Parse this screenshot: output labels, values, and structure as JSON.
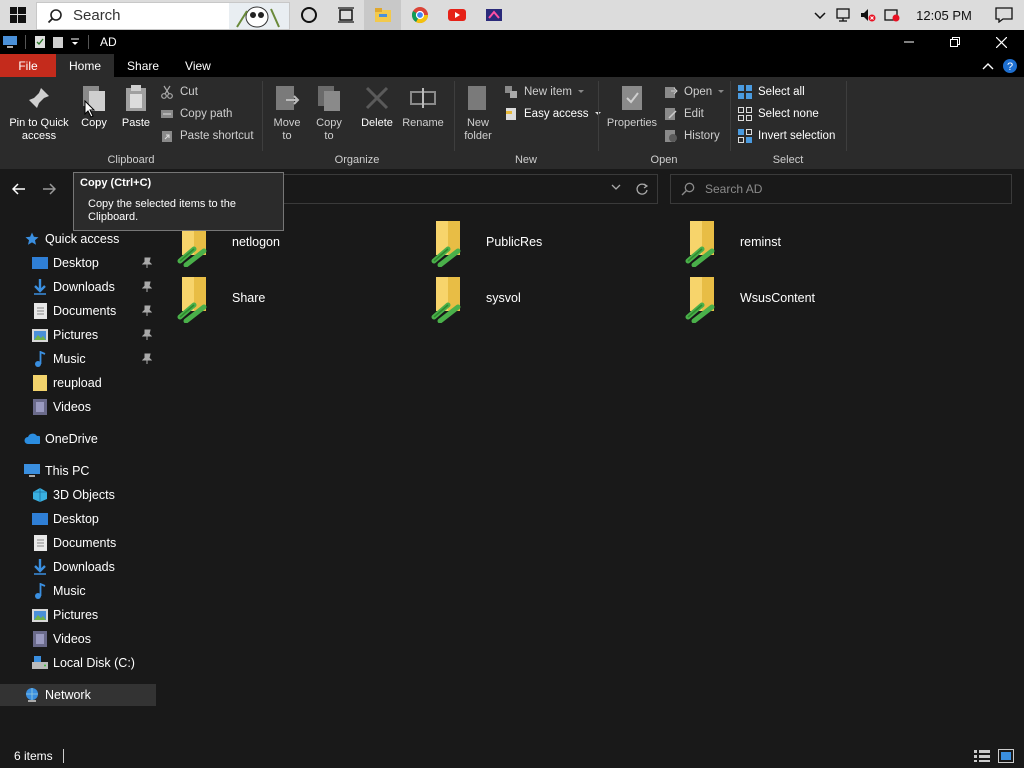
{
  "taskbar": {
    "search_placeholder": "Search",
    "clock": "12:05 PM",
    "pinned": [
      "cortana-icon",
      "task-view-icon",
      "file-explorer-icon",
      "chrome-icon",
      "youtube-icon",
      "video-editor-icon"
    ]
  },
  "window": {
    "title": "AD"
  },
  "ribbon_tabs": [
    "File",
    "Home",
    "Share",
    "View"
  ],
  "ribbon": {
    "clipboard": {
      "label": "Clipboard",
      "pin": "Pin to Quick access",
      "pin_line1": "Pin to Quick",
      "pin_line2": "access",
      "copy": "Copy",
      "paste": "Paste",
      "cut": "Cut",
      "copy_path": "Copy path",
      "paste_shortcut": "Paste shortcut"
    },
    "organize": {
      "label": "Organize",
      "move_to_1": "Move",
      "move_to_2": "to",
      "copy_to_1": "Copy",
      "copy_to_2": "to",
      "delete": "Delete",
      "rename": "Rename"
    },
    "new": {
      "label": "New",
      "new_folder_1": "New",
      "new_folder_2": "folder",
      "new_item": "New item",
      "easy_access": "Easy access"
    },
    "open": {
      "label": "Open",
      "properties": "Properties",
      "open": "Open",
      "edit": "Edit",
      "history": "History"
    },
    "select": {
      "label": "Select",
      "select_all": "Select all",
      "select_none": "Select none",
      "invert": "Invert selection"
    }
  },
  "tooltip": {
    "title": "Copy (Ctrl+C)",
    "body_line1": "Copy the selected items to the",
    "body_line2": "Clipboard."
  },
  "search": {
    "placeholder": "Search AD"
  },
  "nav": {
    "quick_access": "Quick access",
    "quick_items": [
      {
        "label": "Desktop",
        "pinned": true
      },
      {
        "label": "Downloads",
        "pinned": true
      },
      {
        "label": "Documents",
        "pinned": true
      },
      {
        "label": "Pictures",
        "pinned": true
      },
      {
        "label": "Music",
        "pinned": true
      },
      {
        "label": "reupload",
        "pinned": false
      },
      {
        "label": "Videos",
        "pinned": false
      }
    ],
    "onedrive": "OneDrive",
    "this_pc": "This PC",
    "pc_items": [
      "3D Objects",
      "Desktop",
      "Documents",
      "Downloads",
      "Music",
      "Pictures",
      "Videos",
      "Local Disk (C:)"
    ],
    "network": "Network"
  },
  "folders": [
    "netlogon",
    "PublicRes",
    "reminst",
    "Share",
    "sysvol",
    "WsusContent"
  ],
  "status": {
    "count": "6 items"
  }
}
